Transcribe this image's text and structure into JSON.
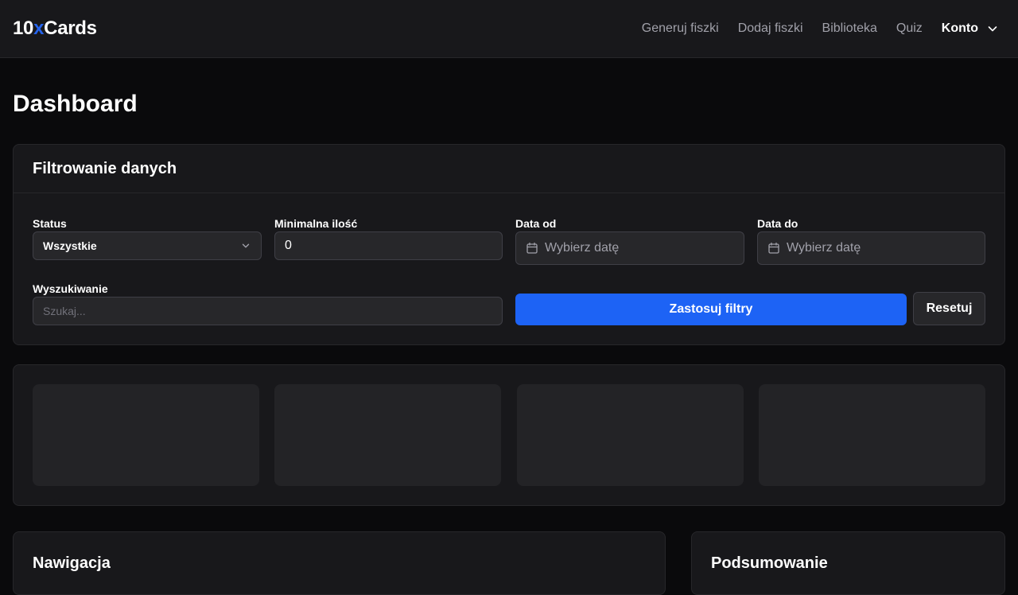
{
  "app": {
    "logo_prefix": "10",
    "logo_accent": "x",
    "logo_suffix": "Cards",
    "accent_color": "#2563eb"
  },
  "nav": {
    "items": [
      {
        "label": "Generuj fiszki"
      },
      {
        "label": "Dodaj fiszki"
      },
      {
        "label": "Biblioteka"
      },
      {
        "label": "Quiz"
      }
    ],
    "account_label": "Konto"
  },
  "page": {
    "title": "Dashboard"
  },
  "filters": {
    "title": "Filtrowanie danych",
    "status": {
      "label": "Status",
      "value": "Wszystkie"
    },
    "min_count": {
      "label": "Minimalna ilość",
      "value": "0"
    },
    "date_from": {
      "label": "Data od",
      "placeholder": "Wybierz datę"
    },
    "date_to": {
      "label": "Data do",
      "placeholder": "Wybierz datę"
    },
    "search": {
      "label": "Wyszukiwanie",
      "placeholder": "Szukaj..."
    },
    "apply_label": "Zastosuj filtry",
    "reset_label": "Resetuj",
    "apply_color": "#1d63f5"
  },
  "sections": {
    "navigation_title": "Nawigacja",
    "summary_title": "Podsumowanie"
  }
}
